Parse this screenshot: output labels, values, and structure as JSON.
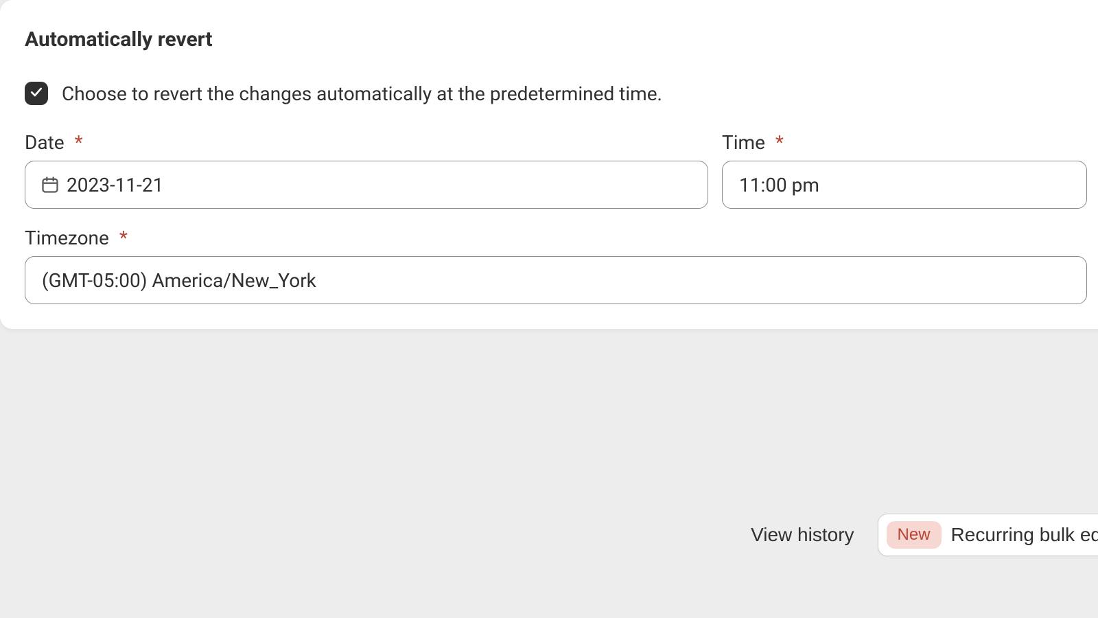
{
  "section": {
    "title": "Automatically revert",
    "checkbox": {
      "checked": true,
      "label": "Choose to revert the changes automatically at the predetermined time."
    },
    "fields": {
      "date": {
        "label": "Date",
        "required_mark": "*",
        "value": "2023-11-21"
      },
      "time": {
        "label": "Time",
        "required_mark": "*",
        "value": "11:00 pm"
      },
      "timezone": {
        "label": "Timezone",
        "required_mark": "*",
        "value": "(GMT-05:00) America/New_York"
      }
    }
  },
  "footer": {
    "view_history_label": "View history",
    "recurring": {
      "badge": "New",
      "label": "Recurring bulk edit"
    }
  }
}
